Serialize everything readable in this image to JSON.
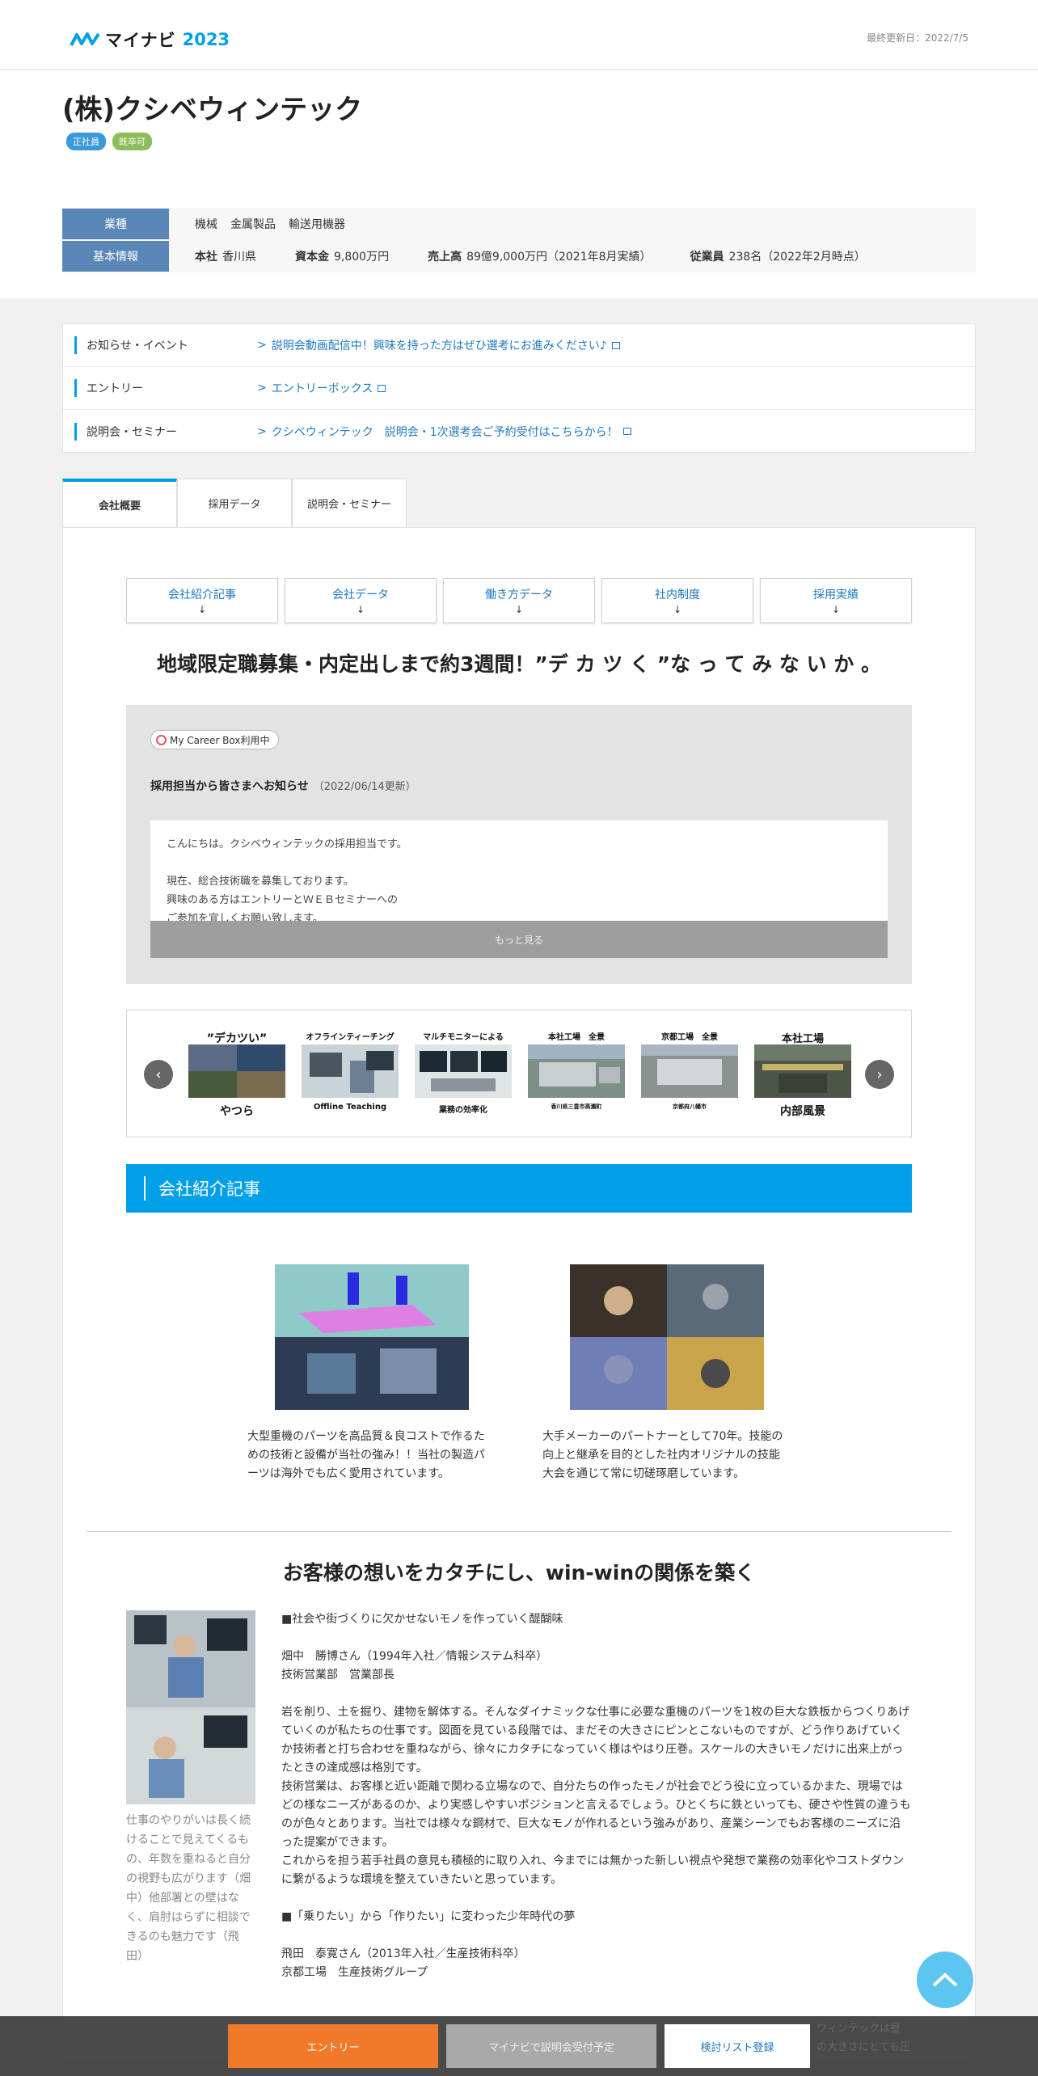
{
  "header": {
    "logo_text": "マイナビ",
    "logo_year": "2023",
    "updated": "最終更新日：2022/7/5"
  },
  "company": {
    "name": "(株)クシベウィンテック",
    "badges": [
      "正社員",
      "既卒可"
    ]
  },
  "info": {
    "industry_label": "業種",
    "industries": [
      "機械",
      "金属製品",
      "輸送用機器"
    ],
    "basic_label": "基本情報",
    "hq_label": "本社",
    "hq": "香川県",
    "capital_label": "資本金",
    "capital": "9,800万円",
    "sales_label": "売上高",
    "sales": "89億9,000万円（2021年8月実績）",
    "employees_label": "従業員",
    "employees": "238名（2022年2月時点）"
  },
  "notices": [
    {
      "label": "お知らせ・イベント",
      "link": "説明会動画配信中！興味を持った方はぜひ選考にお進みください♪"
    },
    {
      "label": "エントリー",
      "link": "エントリーボックス"
    },
    {
      "label": "説明会・セミナー",
      "link": "クシベウィンテック　説明会・1次選考会ご予約受付はこちらから！"
    }
  ],
  "tabs": [
    "会社概要",
    "採用データ",
    "説明会・セミナー"
  ],
  "anchors": [
    "会社紹介記事",
    "会社データ",
    "働き方データ",
    "社内制度",
    "採用実績"
  ],
  "anchor_arrow": "↓",
  "catch": "地域限定職募集・内定出しまで約3週間！”デ カ ツ く ”な っ て み な い か 。",
  "message": {
    "badge": "My Career Box利用中",
    "title": "採用担当から皆さまへお知らせ",
    "date": "（2022/06/14更新）",
    "body": "こんにちは。クシベウィンテックの採用担当です。\n\n現在、総合技術職を募集しております。\n興味のある方はエントリーとＷＥＢセミナーへの\nご参加を宜しくお願い致します。",
    "more": "もっと見る"
  },
  "carousel": {
    "prev": "‹",
    "next": "›",
    "slides": [
      {
        "top": "”デカツい”",
        "bottom": "やつら"
      },
      {
        "top": "オフラインティーチング",
        "bottom": "Offline Teaching"
      },
      {
        "top": "マルチモニターによる",
        "bottom": "業務の効率化"
      },
      {
        "top": "本社工場　全景",
        "bottom": "香川県三豊市高瀬町"
      },
      {
        "top": "京都工場　全景",
        "bottom": "京都府八幡市"
      },
      {
        "top": "本社工場",
        "bottom": "内部風景"
      }
    ]
  },
  "section_title": "会社紹介記事",
  "articles": [
    {
      "caption": "大型重機のパーツを高品質＆良コストで作るための技術と設備が当社の強み！！当社の製造パーツは海外でも広く愛用されています。"
    },
    {
      "caption": "大手メーカーのパートナーとして70年。技能の向上と継承を目的とした社内オリジナルの技能大会を通じて常に切磋琢磨しています。"
    }
  ],
  "section2": {
    "title": "お客様の想いをカタチにし、win-winの関係を築く",
    "side_caption": "仕事のやりがいは長く続けることで見えてくるもの、年数を重ねると自分の視野も広がります（畑中）他部署との壁はなく、肩肘はらずに相談できるのも魅力です（飛田）",
    "paragraphs": [
      "■社会や街づくりに欠かせないモノを作っていく醍醐味",
      "畑中　勝博さん（1994年入社／情報システム科卒）\n技術営業部　営業部長",
      "岩を削り、土を掘り、建物を解体する。そんなダイナミックな仕事に必要な重機のパーツを1枚の巨大な鉄板からつくりあげていくのが私たちの仕事です。図面を見ている段階では、まだその大きさにピンとこないものですが、どう作りあげていくか技術者と打ち合わせを重ねながら、徐々にカタチになっていく様はやはり圧巻。スケールの大きいモノだけに出来上がったときの達成感は格別です。\n技術営業は、お客様と近い距離で関わる立場なので、自分たちの作ったモノが社会でどう役に立っているかまた、現場ではどの様なニーズがあるのか、より実感しやすいポジションと言えるでしょう。ひとくちに鉄といっても、硬さや性質の違うものが色々とあります。当社では様々な鋼材で、巨大なモノが作れるという強みがあり、産業シーンでもお客様のニーズに沿った提案ができます。\nこれからを担う若手社員の意見も積極的に取り入れ、今までには無かった新しい視点や発想で業務の効率化やコストダウンに繋がるような環境を整えていきたいと思っています。",
      "■「乗りたい」から「作りたい」に変わった少年時代の夢",
      "飛田　泰寛さん（2013年入社／生産技術科卒）\n京都工場　生産技術グループ"
    ],
    "peek": "ウィンテックは昼\nの大きさにとても圧"
  },
  "bottom_bar": {
    "entry": "エントリー",
    "seminar": "マイナビで説明会受付予定",
    "list": "検討リスト登録"
  },
  "colors": {
    "accent": "#00a0e9",
    "label_blue": "#5b87b8",
    "entry_orange": "#f07a2a",
    "link": "#1d78c1"
  }
}
